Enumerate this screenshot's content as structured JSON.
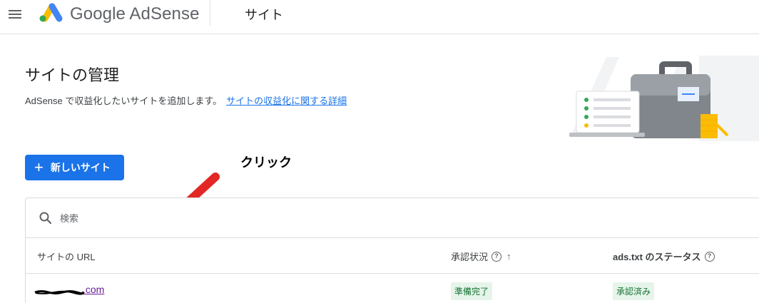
{
  "topbar": {
    "brand": "Google AdSense",
    "section": "サイト"
  },
  "header": {
    "title": "サイトの管理",
    "description": "AdSense で収益化したいサイトを追加します。",
    "link": "サイトの収益化に関する詳細"
  },
  "actions": {
    "new_site_icon": "+",
    "new_site_label": "新しいサイト"
  },
  "annotation": {
    "label": "クリック"
  },
  "search": {
    "placeholder": "検索"
  },
  "table": {
    "headers": {
      "url": "サイトの URL",
      "approval": "承認状況",
      "ads_txt": "ads.txt のステータス"
    },
    "help_icon": "?",
    "sort_icon": "↑",
    "rows": [
      {
        "url_visible": ".com",
        "approval": "準備完了",
        "ads_txt": "承認済み"
      }
    ]
  },
  "colors": {
    "primary": "#1a73e8",
    "badge_bg": "#e6f4ea",
    "badge_text": "#137333",
    "annotation_arrow": "#e32726"
  },
  "icons": [
    "menu-icon",
    "adsense-logo-icon",
    "search-icon",
    "help-icon",
    "sort-arrow-icon",
    "plus-icon"
  ]
}
